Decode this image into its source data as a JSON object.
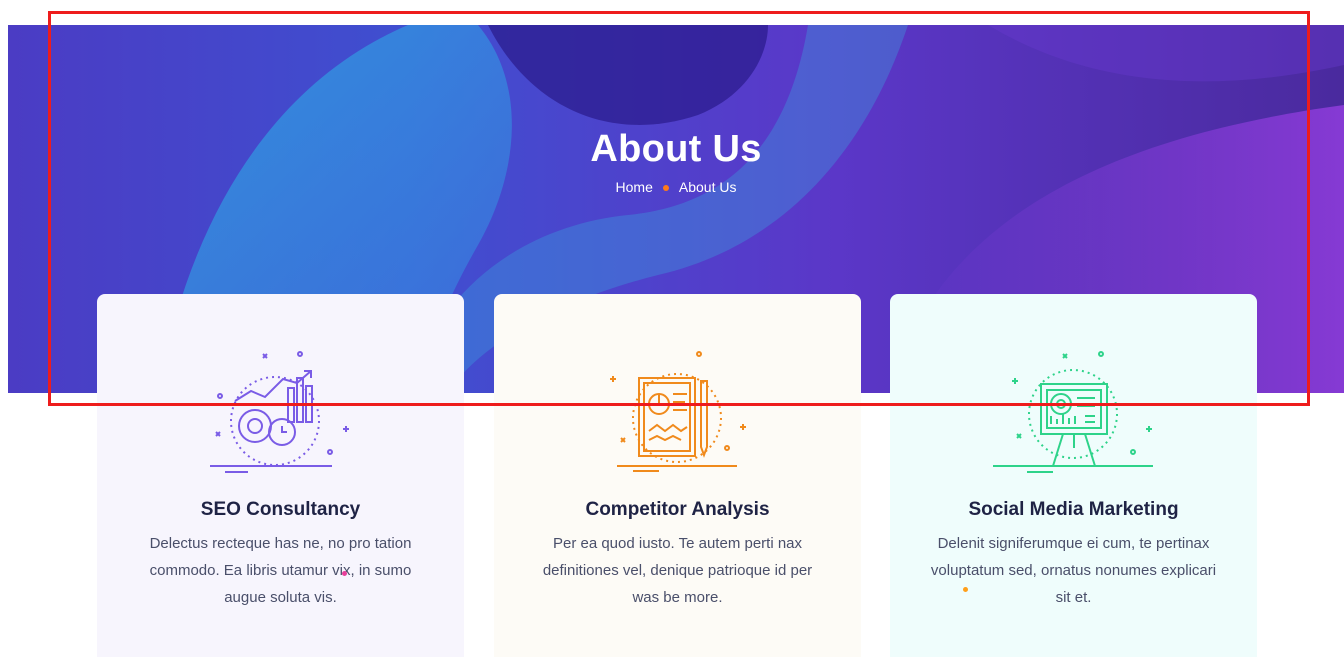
{
  "hero": {
    "title": "About Us",
    "breadcrumb": {
      "home": "Home",
      "current": "About Us"
    }
  },
  "colors": {
    "card1_icon": "#7a5ce6",
    "card2_icon": "#f08a1c",
    "card3_icon": "#2ed38a",
    "dot_accent": "#ff7a1a",
    "highlight_box": "#ee1c1c"
  },
  "cards": [
    {
      "icon": "seo-gears-chart-icon",
      "title": "SEO Consultancy",
      "description": "Delectus recteque has ne, no pro tation commodo. Ea libris utamur vix, in sumo augue soluta vis.",
      "background": "#f7f5fd"
    },
    {
      "icon": "report-document-icon",
      "title": "Competitor Analysis",
      "description": "Per ea quod iusto. Te autem perti nax definitiones vel, denique patrioque id per was be more.",
      "background": "#fdfbf6"
    },
    {
      "icon": "presentation-board-icon",
      "title": "Social Media Marketing",
      "description": "Delenit signiferumque ei cum, te pertinax voluptatum sed, ornatus nonumes explicari sit et.",
      "background": "#effdfc"
    }
  ]
}
